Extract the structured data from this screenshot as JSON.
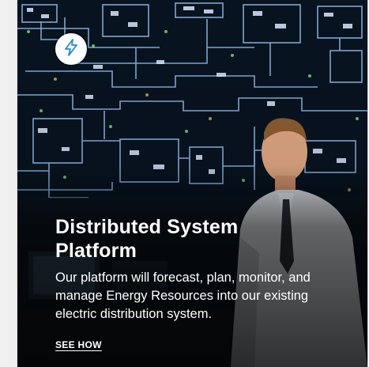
{
  "card": {
    "icon": "lightning-bolt-icon",
    "title": "Distributed System Platform",
    "description": "Our platform will forecast, plan, monitor, and manage Energy Resources into our existing electric distribution system.",
    "cta_label": "SEE HOW"
  },
  "colors": {
    "icon_blue": "#1f8fcf",
    "text": "#ffffff",
    "background": "#06121d"
  }
}
